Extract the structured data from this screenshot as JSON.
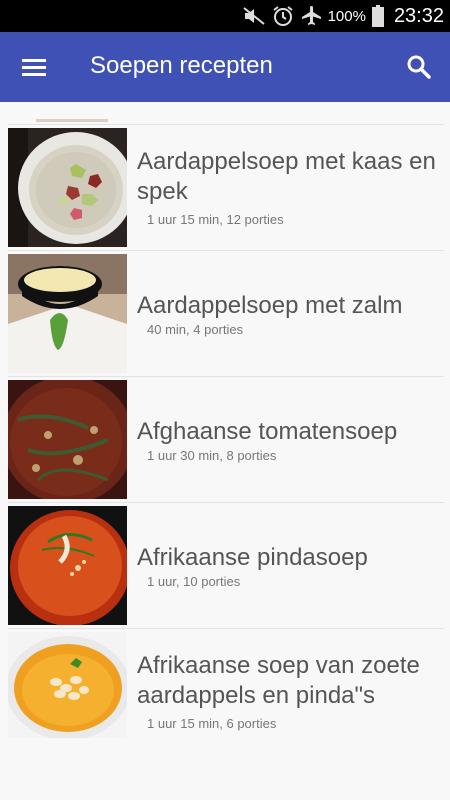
{
  "status_bar": {
    "battery": "100%",
    "time": "23:32",
    "icons": [
      "mute-icon",
      "alarm-icon",
      "airplane-icon",
      "battery-icon"
    ]
  },
  "app_bar": {
    "title": "Soepen recepten",
    "menu_icon": "hamburger-menu-icon",
    "search_icon": "search-icon",
    "color": "#3f51b5"
  },
  "recipes": [
    {
      "name": "Aardappelsoep met kaas en spek",
      "meta": "1 uur 15 min, 12 porties"
    },
    {
      "name": "Aardappelsoep met zalm",
      "meta": "40 min, 4 porties"
    },
    {
      "name": "Afghaanse tomatensoep",
      "meta": "1 uur 30 min, 8 porties"
    },
    {
      "name": "Afrikaanse pindasoep",
      "meta": "1 uur, 10 porties"
    },
    {
      "name": "Afrikaanse soep van zoete aardappels en pinda\"s",
      "meta": "1 uur 15 min, 6 porties"
    }
  ]
}
